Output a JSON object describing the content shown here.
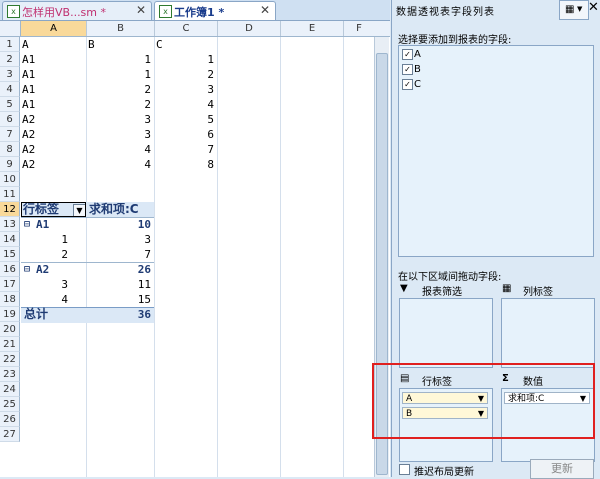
{
  "tabs": [
    {
      "label": "怎样用VB...sm *",
      "color": "#c03070"
    },
    {
      "label": "工作簿1 *",
      "color": "#1a3c8c"
    }
  ],
  "columns": [
    "A",
    "B",
    "C",
    "D",
    "E",
    "F"
  ],
  "rows": [
    "1",
    "2",
    "3",
    "4",
    "5",
    "6",
    "7",
    "8",
    "9",
    "10",
    "11",
    "12",
    "13",
    "14",
    "15",
    "16",
    "17",
    "18",
    "19",
    "20",
    "21",
    "22",
    "23",
    "24",
    "25",
    "26",
    "27"
  ],
  "data_rows": [
    [
      "A",
      "B",
      "C"
    ],
    [
      "A1",
      "1",
      "1"
    ],
    [
      "A1",
      "1",
      "2"
    ],
    [
      "A1",
      "2",
      "3"
    ],
    [
      "A1",
      "2",
      "4"
    ],
    [
      "A2",
      "3",
      "5"
    ],
    [
      "A2",
      "3",
      "6"
    ],
    [
      "A2",
      "4",
      "7"
    ],
    [
      "A2",
      "4",
      "8"
    ]
  ],
  "pivot": {
    "row_header": "行标签",
    "value_header": "求和项:C",
    "groups": [
      {
        "name": "A1",
        "total": "10",
        "items": [
          {
            "b": "1",
            "v": "3"
          },
          {
            "b": "2",
            "v": "7"
          }
        ]
      },
      {
        "name": "A2",
        "total": "26",
        "items": [
          {
            "b": "3",
            "v": "11"
          },
          {
            "b": "4",
            "v": "15"
          }
        ]
      }
    ],
    "grand_label": "总计",
    "grand_total": "36"
  },
  "pane": {
    "title": "数据透视表字段列表",
    "choose_label": "选择要添加到报表的字段:",
    "fields": [
      "A",
      "B",
      "C"
    ],
    "drag_label": "在以下区域间拖动字段:",
    "filter_label": "报表筛选",
    "col_label": "列标签",
    "row_label": "行标签",
    "val_label": "数值",
    "row_items": [
      "A",
      "B"
    ],
    "val_items": [
      "求和项:C"
    ],
    "defer_label": "推迟布局更新",
    "update_label": "更新"
  }
}
